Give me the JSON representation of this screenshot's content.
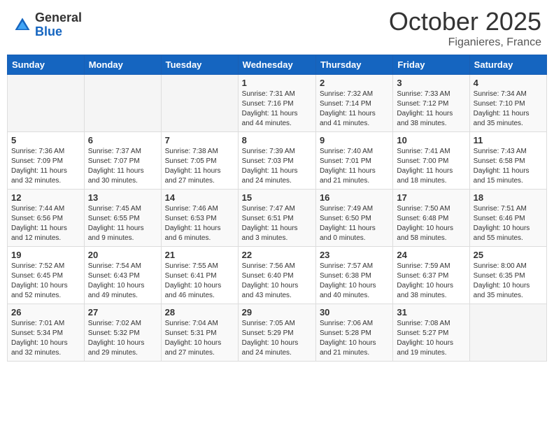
{
  "header": {
    "logo_general": "General",
    "logo_blue": "Blue",
    "month_title": "October 2025",
    "location": "Figanieres, France"
  },
  "days_of_week": [
    "Sunday",
    "Monday",
    "Tuesday",
    "Wednesday",
    "Thursday",
    "Friday",
    "Saturday"
  ],
  "weeks": [
    [
      {
        "day": "",
        "info": ""
      },
      {
        "day": "",
        "info": ""
      },
      {
        "day": "",
        "info": ""
      },
      {
        "day": "1",
        "info": "Sunrise: 7:31 AM\nSunset: 7:16 PM\nDaylight: 11 hours\nand 44 minutes."
      },
      {
        "day": "2",
        "info": "Sunrise: 7:32 AM\nSunset: 7:14 PM\nDaylight: 11 hours\nand 41 minutes."
      },
      {
        "day": "3",
        "info": "Sunrise: 7:33 AM\nSunset: 7:12 PM\nDaylight: 11 hours\nand 38 minutes."
      },
      {
        "day": "4",
        "info": "Sunrise: 7:34 AM\nSunset: 7:10 PM\nDaylight: 11 hours\nand 35 minutes."
      }
    ],
    [
      {
        "day": "5",
        "info": "Sunrise: 7:36 AM\nSunset: 7:09 PM\nDaylight: 11 hours\nand 32 minutes."
      },
      {
        "day": "6",
        "info": "Sunrise: 7:37 AM\nSunset: 7:07 PM\nDaylight: 11 hours\nand 30 minutes."
      },
      {
        "day": "7",
        "info": "Sunrise: 7:38 AM\nSunset: 7:05 PM\nDaylight: 11 hours\nand 27 minutes."
      },
      {
        "day": "8",
        "info": "Sunrise: 7:39 AM\nSunset: 7:03 PM\nDaylight: 11 hours\nand 24 minutes."
      },
      {
        "day": "9",
        "info": "Sunrise: 7:40 AM\nSunset: 7:01 PM\nDaylight: 11 hours\nand 21 minutes."
      },
      {
        "day": "10",
        "info": "Sunrise: 7:41 AM\nSunset: 7:00 PM\nDaylight: 11 hours\nand 18 minutes."
      },
      {
        "day": "11",
        "info": "Sunrise: 7:43 AM\nSunset: 6:58 PM\nDaylight: 11 hours\nand 15 minutes."
      }
    ],
    [
      {
        "day": "12",
        "info": "Sunrise: 7:44 AM\nSunset: 6:56 PM\nDaylight: 11 hours\nand 12 minutes."
      },
      {
        "day": "13",
        "info": "Sunrise: 7:45 AM\nSunset: 6:55 PM\nDaylight: 11 hours\nand 9 minutes."
      },
      {
        "day": "14",
        "info": "Sunrise: 7:46 AM\nSunset: 6:53 PM\nDaylight: 11 hours\nand 6 minutes."
      },
      {
        "day": "15",
        "info": "Sunrise: 7:47 AM\nSunset: 6:51 PM\nDaylight: 11 hours\nand 3 minutes."
      },
      {
        "day": "16",
        "info": "Sunrise: 7:49 AM\nSunset: 6:50 PM\nDaylight: 11 hours\nand 0 minutes."
      },
      {
        "day": "17",
        "info": "Sunrise: 7:50 AM\nSunset: 6:48 PM\nDaylight: 10 hours\nand 58 minutes."
      },
      {
        "day": "18",
        "info": "Sunrise: 7:51 AM\nSunset: 6:46 PM\nDaylight: 10 hours\nand 55 minutes."
      }
    ],
    [
      {
        "day": "19",
        "info": "Sunrise: 7:52 AM\nSunset: 6:45 PM\nDaylight: 10 hours\nand 52 minutes."
      },
      {
        "day": "20",
        "info": "Sunrise: 7:54 AM\nSunset: 6:43 PM\nDaylight: 10 hours\nand 49 minutes."
      },
      {
        "day": "21",
        "info": "Sunrise: 7:55 AM\nSunset: 6:41 PM\nDaylight: 10 hours\nand 46 minutes."
      },
      {
        "day": "22",
        "info": "Sunrise: 7:56 AM\nSunset: 6:40 PM\nDaylight: 10 hours\nand 43 minutes."
      },
      {
        "day": "23",
        "info": "Sunrise: 7:57 AM\nSunset: 6:38 PM\nDaylight: 10 hours\nand 40 minutes."
      },
      {
        "day": "24",
        "info": "Sunrise: 7:59 AM\nSunset: 6:37 PM\nDaylight: 10 hours\nand 38 minutes."
      },
      {
        "day": "25",
        "info": "Sunrise: 8:00 AM\nSunset: 6:35 PM\nDaylight: 10 hours\nand 35 minutes."
      }
    ],
    [
      {
        "day": "26",
        "info": "Sunrise: 7:01 AM\nSunset: 5:34 PM\nDaylight: 10 hours\nand 32 minutes."
      },
      {
        "day": "27",
        "info": "Sunrise: 7:02 AM\nSunset: 5:32 PM\nDaylight: 10 hours\nand 29 minutes."
      },
      {
        "day": "28",
        "info": "Sunrise: 7:04 AM\nSunset: 5:31 PM\nDaylight: 10 hours\nand 27 minutes."
      },
      {
        "day": "29",
        "info": "Sunrise: 7:05 AM\nSunset: 5:29 PM\nDaylight: 10 hours\nand 24 minutes."
      },
      {
        "day": "30",
        "info": "Sunrise: 7:06 AM\nSunset: 5:28 PM\nDaylight: 10 hours\nand 21 minutes."
      },
      {
        "day": "31",
        "info": "Sunrise: 7:08 AM\nSunset: 5:27 PM\nDaylight: 10 hours\nand 19 minutes."
      },
      {
        "day": "",
        "info": ""
      }
    ]
  ]
}
